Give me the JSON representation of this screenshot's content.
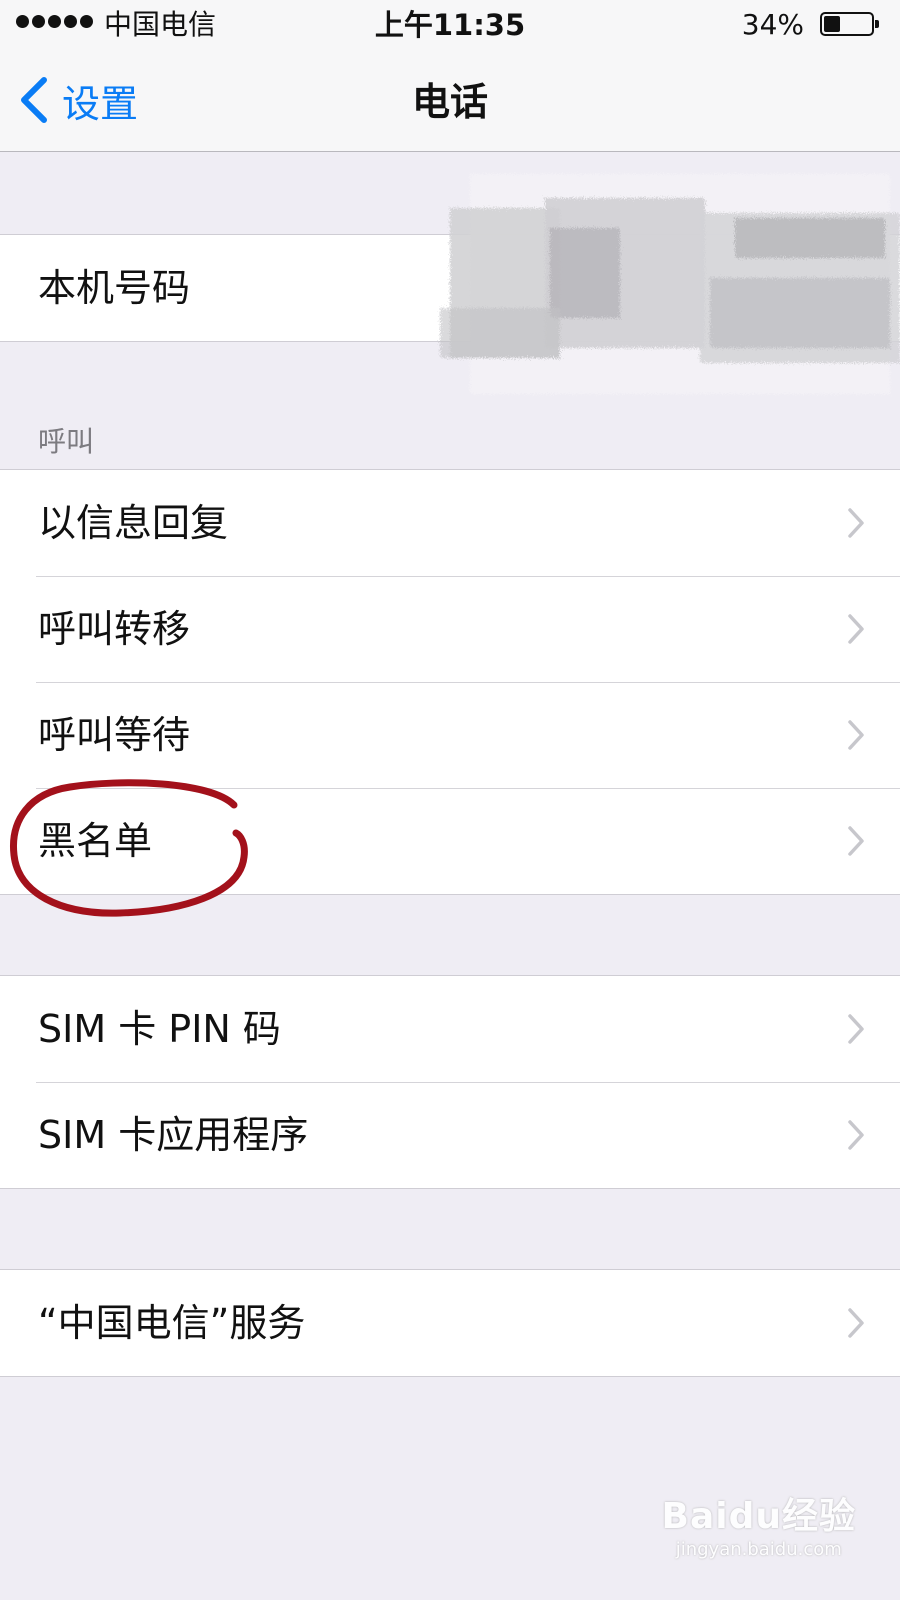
{
  "status_bar": {
    "carrier": "中国电信",
    "time": "上午11:35",
    "battery_percent_label": "34%",
    "battery_level": 0.34
  },
  "nav": {
    "back_label": "设置",
    "title": "电话"
  },
  "sections": {
    "my_number": {
      "label": "本机号码"
    },
    "calls": {
      "header": "呼叫",
      "items": [
        {
          "label": "以信息回复"
        },
        {
          "label": "呼叫转移"
        },
        {
          "label": "呼叫等待"
        },
        {
          "label": "黑名单"
        }
      ]
    },
    "sim": {
      "items": [
        {
          "label": "SIM 卡 PIN 码"
        },
        {
          "label": "SIM 卡应用程序"
        }
      ]
    },
    "carrier_services": {
      "label": "“中国电信”服务"
    }
  },
  "watermark": {
    "logo": "Baidu经验",
    "url": "jingyan.baidu.com"
  },
  "colors": {
    "accent": "#0a7cf5",
    "annotation": "#a3111b",
    "background": "#efedf4"
  }
}
